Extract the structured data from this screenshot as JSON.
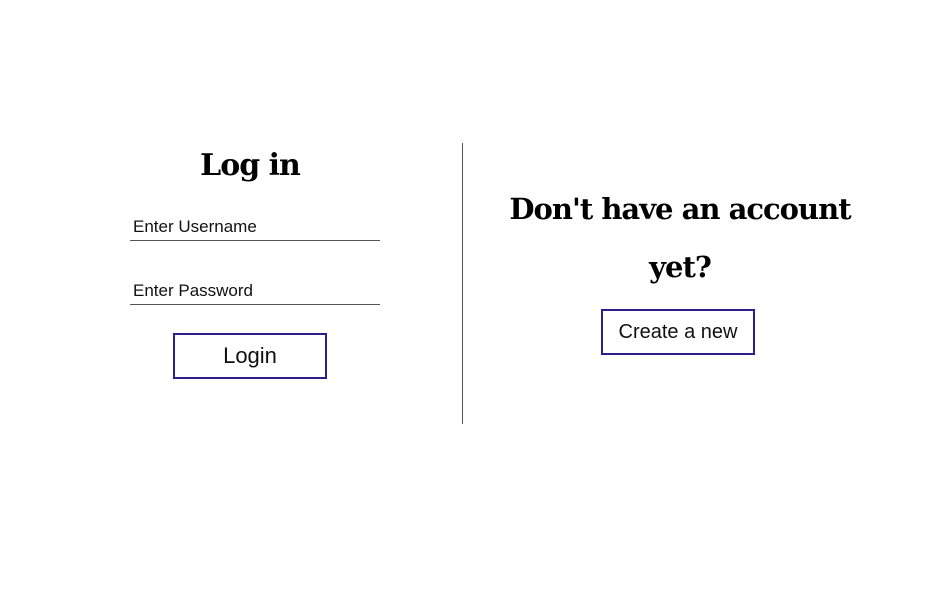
{
  "login": {
    "title": "Log in",
    "username_placeholder": "Enter Username",
    "password_placeholder": "Enter Password",
    "button_label": "Login"
  },
  "signup": {
    "title": "Don't have an account yet?",
    "button_label": "Create a new"
  },
  "colors": {
    "button_border": "#2e1f8f",
    "divider": "#555555"
  }
}
